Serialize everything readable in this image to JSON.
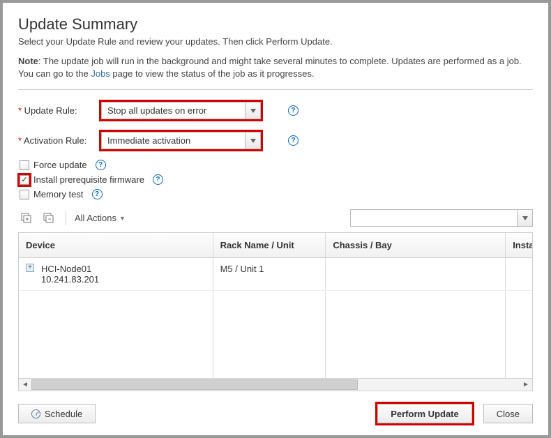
{
  "header": {
    "title": "Update Summary",
    "subtitle": "Select your Update Rule and review your updates. Then click Perform Update.",
    "note_prefix": "Note",
    "note_body_1": ": The update job will run in the background and might take several minutes to complete. Updates are performed as a job. You can go to the ",
    "note_link": "Jobs",
    "note_body_2": " page to view the status of the job as it progresses."
  },
  "form": {
    "update_rule_label": "Update Rule:",
    "update_rule_value": "Stop all updates on error",
    "activation_rule_label": "Activation Rule:",
    "activation_rule_value": "Immediate activation",
    "force_update_label": "Force update",
    "force_update_checked": false,
    "install_prereq_label": "Install prerequisite firmware",
    "install_prereq_checked": true,
    "memory_test_label": "Memory test",
    "memory_test_checked": false
  },
  "toolbar": {
    "all_actions_label": "All Actions",
    "filter_value": ""
  },
  "table": {
    "columns": {
      "device": "Device",
      "rack": "Rack Name / Unit",
      "chassis": "Chassis / Bay",
      "installed": "Installed Version"
    },
    "rows": [
      {
        "device_name": "HCI-Node01",
        "device_ip": "10.241.83.201",
        "rack": "M5 / Unit 1",
        "chassis": "",
        "installed": ""
      }
    ]
  },
  "footer": {
    "schedule": "Schedule",
    "perform": "Perform Update",
    "close": "Close"
  }
}
